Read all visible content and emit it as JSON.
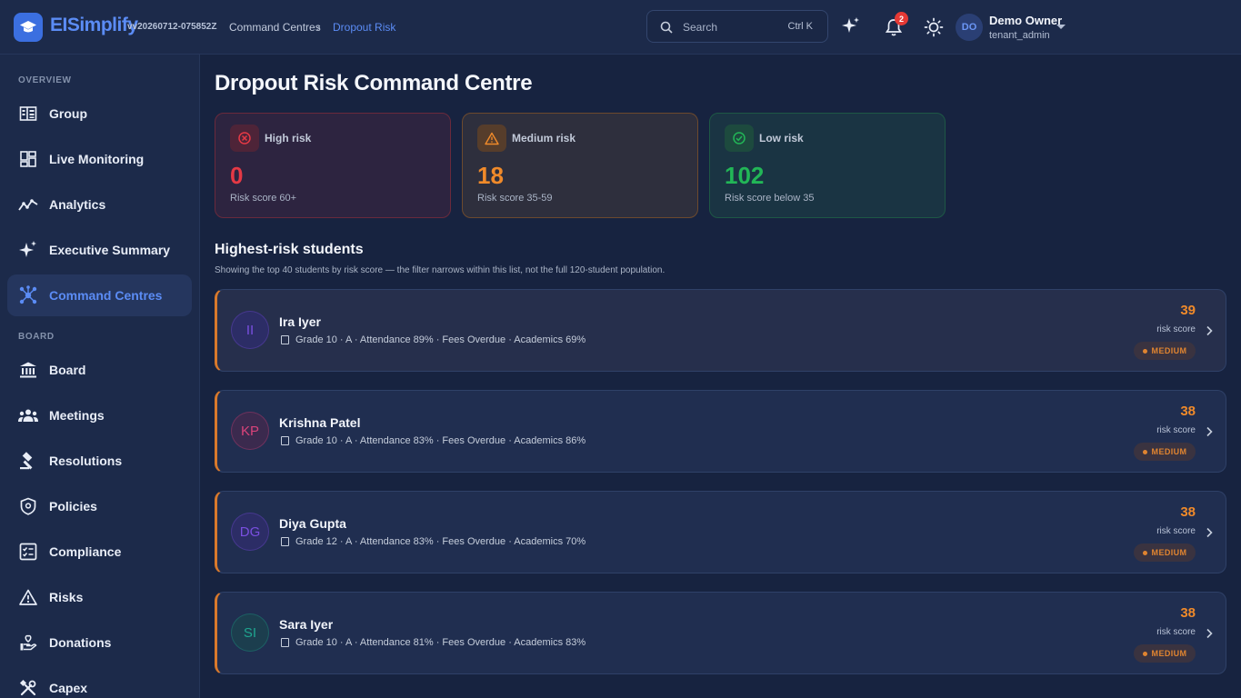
{
  "header": {
    "brand": "EISimplify",
    "version": "vv20260712-075852Z",
    "breadcrumb": [
      "Command Centres",
      "Dropout Risk"
    ],
    "search_placeholder": "Search",
    "search_shortcut": "Ctrl K",
    "notification_count": "2",
    "user": {
      "initials": "DO",
      "name": "Demo Owner",
      "role": "tenant_admin"
    }
  },
  "sidebar": {
    "sections": [
      "OVERVIEW",
      "BOARD"
    ],
    "items": [
      {
        "label": "Group",
        "icon": "building-icon"
      },
      {
        "label": "Live Monitoring",
        "icon": "dashboard-icon"
      },
      {
        "label": "Analytics",
        "icon": "analytics-icon"
      },
      {
        "label": "Executive Summary",
        "icon": "sparkle-icon"
      },
      {
        "label": "Command Centres",
        "icon": "hub-icon",
        "active": true
      },
      {
        "label": "Board",
        "icon": "bank-icon"
      },
      {
        "label": "Meetings",
        "icon": "people-icon"
      },
      {
        "label": "Resolutions",
        "icon": "gavel-icon"
      },
      {
        "label": "Policies",
        "icon": "shield-icon"
      },
      {
        "label": "Compliance",
        "icon": "checklist-icon"
      },
      {
        "label": "Risks",
        "icon": "warning-icon"
      },
      {
        "label": "Donations",
        "icon": "donation-icon"
      },
      {
        "label": "Capex",
        "icon": "tools-icon"
      }
    ]
  },
  "page": {
    "title": "Dropout Risk Command Centre"
  },
  "stats": {
    "high": {
      "label": "High risk",
      "value": "0",
      "sub": "Risk score 60+",
      "color": "#e53945"
    },
    "medium": {
      "label": "Medium risk",
      "value": "18",
      "sub": "Risk score 35-59",
      "color": "#f08a2a"
    },
    "low": {
      "label": "Low risk",
      "value": "102",
      "sub": "Risk score below 35",
      "color": "#22b657"
    }
  },
  "students_section": {
    "title": "Highest-risk students",
    "subtitle": "Showing the top 40 students by risk score — the filter narrows within this list, not the full 120-student population.",
    "score_label": "risk score",
    "students": [
      {
        "initials": "II",
        "name": "Ira Iyer",
        "meta": "Grade 10 · A · Attendance 89% · Fees Overdue · Academics 69%",
        "score": "39",
        "level": "MEDIUM",
        "avatar_color": "#7a4fe0",
        "avatar_bg": "#2c2d66"
      },
      {
        "initials": "KP",
        "name": "Krishna Patel",
        "meta": "Grade 10 · A · Attendance 83% · Fees Overdue · Academics 86%",
        "score": "38",
        "level": "MEDIUM",
        "avatar_color": "#d9437a",
        "avatar_bg": "#3b2a4e"
      },
      {
        "initials": "DG",
        "name": "Diya Gupta",
        "meta": "Grade 12 · A · Attendance 83% · Fees Overdue · Academics 70%",
        "score": "38",
        "level": "MEDIUM",
        "avatar_color": "#7a4fe0",
        "avatar_bg": "#2c2d66"
      },
      {
        "initials": "SI",
        "name": "Sara Iyer",
        "meta": "Grade 10 · A · Attendance 81% · Fees Overdue · Academics 83%",
        "score": "38",
        "level": "MEDIUM",
        "avatar_color": "#1fa58f",
        "avatar_bg": "#1c3e4e"
      }
    ]
  }
}
